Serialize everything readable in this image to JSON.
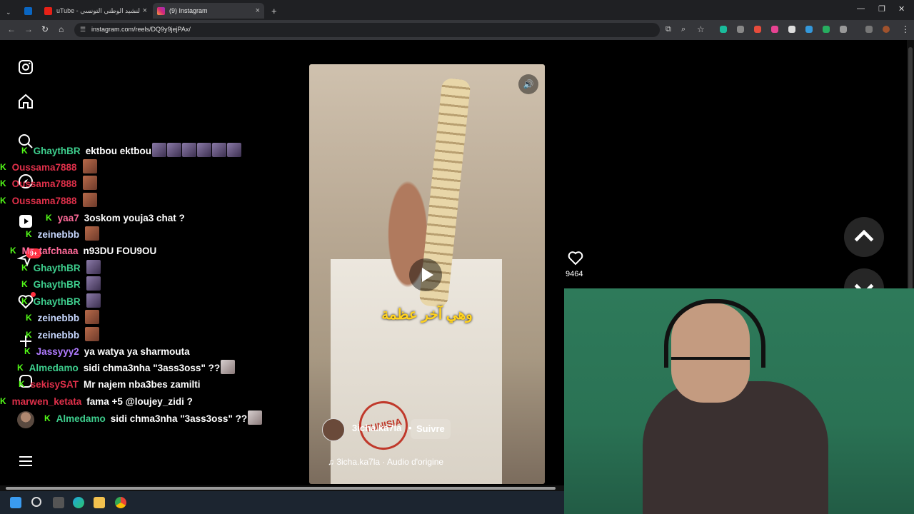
{
  "browser": {
    "tabs": [
      {
        "title": "uTube - النشيد الوطني التونسي",
        "close": "×"
      },
      {
        "title": "(9) Instagram",
        "close": "×"
      }
    ],
    "new_tab": "+",
    "url": "instagram.com/reels/DQ9y9jejPAx/"
  },
  "chat": [
    {
      "user": "GhaythBR",
      "user_color": "#3ecf8e",
      "message": "ektbou ektbou",
      "emotes": 6,
      "emote_style": "purple"
    },
    {
      "user": "Oussama7888",
      "user_color": "#e0304a",
      "message": "",
      "emotes": 1,
      "emote_style": "brown"
    },
    {
      "user": "Oussama7888",
      "user_color": "#e0304a",
      "message": "",
      "emotes": 1,
      "emote_style": "brown"
    },
    {
      "user": "Oussama7888",
      "user_color": "#e0304a",
      "message": "",
      "emotes": 1,
      "emote_style": "brown"
    },
    {
      "user": "yaa7",
      "user_color": "#ff6b9a",
      "message": "3oskom youja3 chat ?",
      "emotes": 0,
      "emote_style": ""
    },
    {
      "user": "zeinebbb",
      "user_color": "#c8d8ff",
      "message": "",
      "emotes": 1,
      "emote_style": "brown"
    },
    {
      "user": "Mr_tafchaaa",
      "user_color": "#ff6b9a",
      "message": "n93DU FOU9OU",
      "emotes": 0,
      "emote_style": ""
    },
    {
      "user": "GhaythBR",
      "user_color": "#3ecf8e",
      "message": "",
      "emotes": 1,
      "emote_style": "purple"
    },
    {
      "user": "GhaythBR",
      "user_color": "#3ecf8e",
      "message": "",
      "emotes": 1,
      "emote_style": "purple"
    },
    {
      "user": "GhaythBR",
      "user_color": "#3ecf8e",
      "message": "",
      "emotes": 1,
      "emote_style": "purple"
    },
    {
      "user": "zeinebbb",
      "user_color": "#c8d8ff",
      "message": "",
      "emotes": 1,
      "emote_style": "brown"
    },
    {
      "user": "zeinebbb",
      "user_color": "#c8d8ff",
      "message": "",
      "emotes": 1,
      "emote_style": "brown"
    },
    {
      "user": "Jassyyy2",
      "user_color": "#b07bff",
      "message": "ya watya ya sharmouta",
      "emotes": 0,
      "emote_style": ""
    },
    {
      "user": "Almedamo",
      "user_color": "#3ecf8e",
      "message": "sidi chma3nha \"3ass3oss\" ??",
      "emotes": 1,
      "emote_style": "cat"
    },
    {
      "user": "sekisySAT",
      "user_color": "#e0304a",
      "message": "Mr najem nba3bes zamilti",
      "emotes": 0,
      "emote_style": ""
    },
    {
      "user": "marwen_ketata",
      "user_color": "#e0304a",
      "message": "fama +5 @loujey_zidi ?",
      "emotes": 0,
      "emote_style": ""
    },
    {
      "user": "Almedamo",
      "user_color": "#3ecf8e",
      "message": "sidi chma3nha \"3ass3oss\" ??",
      "emotes": 1,
      "emote_style": "cat"
    }
  ],
  "chat_badge": "K",
  "notification_badge": "9+",
  "reel": {
    "caption": "وهي آخر عظمة",
    "author": "3icha.ka7la",
    "follow_label": "Suivre",
    "separator": "•",
    "audio": "3icha.ka7la · Audio d'origine",
    "stamp": "TUNISIA",
    "like_count": "9464"
  },
  "icons": {
    "sidebar": [
      "instagram-logo-icon",
      "home-icon",
      "search-icon",
      "explore-icon",
      "reels-icon",
      "messages-icon",
      "notifications-icon",
      "create-icon",
      "profile-icon",
      "menu-icon"
    ],
    "reel": [
      "mute-icon",
      "play-icon",
      "heart-icon",
      "music-note-icon"
    ],
    "nav": [
      "chevron-up-icon",
      "chevron-down-icon"
    ]
  }
}
